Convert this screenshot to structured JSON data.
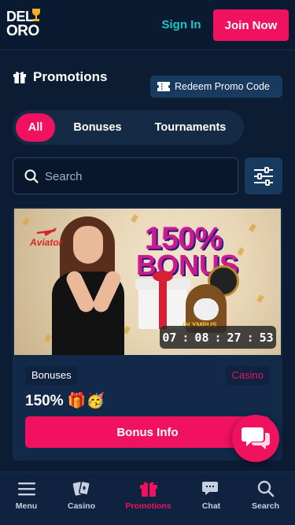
{
  "header": {
    "logo_line1": "DEL",
    "logo_line2": "ORO",
    "sign_in": "Sign In",
    "join_now": "Join Now"
  },
  "promotions": {
    "title": "Promotions",
    "redeem_label": "Redeem Promo Code"
  },
  "tabs": [
    {
      "label": "All",
      "active": true
    },
    {
      "label": "Bonuses",
      "active": false
    },
    {
      "label": "Tournaments",
      "active": false
    }
  ],
  "search": {
    "placeholder": "Search"
  },
  "card": {
    "banner": {
      "provider": "Aviator",
      "headline": "150%",
      "subheadline": "BONUS",
      "game_logo": "OLYMPUS",
      "countdown": {
        "hours": "07",
        "minutes": "08",
        "seconds": "27",
        "centis": "53"
      }
    },
    "tag_left": "Bonuses",
    "tag_right": "Casino",
    "title": "150% 🎁🥳",
    "button": "Bonus Info"
  },
  "nav": [
    {
      "label": "Menu",
      "icon": "menu-icon",
      "active": false
    },
    {
      "label": "Casino",
      "icon": "cards-icon",
      "active": false
    },
    {
      "label": "Promotions",
      "icon": "gift-icon",
      "active": true
    },
    {
      "label": "Chat",
      "icon": "chat-icon",
      "active": false
    },
    {
      "label": "Search",
      "icon": "search-icon",
      "active": false
    }
  ],
  "colors": {
    "accent": "#f0125e",
    "teal": "#1ec6c6",
    "background": "#0b1c33",
    "panel": "#142a45"
  }
}
